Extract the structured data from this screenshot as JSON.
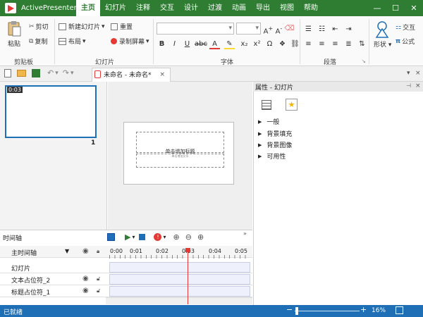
{
  "app": {
    "name": "ActivePresenter"
  },
  "menu_tabs": [
    "主页",
    "幻灯片",
    "注释",
    "交互",
    "设计",
    "过渡",
    "动画",
    "导出",
    "视图",
    "帮助"
  ],
  "ribbon": {
    "clipboard": {
      "paste": "粘贴",
      "cut": "剪切",
      "copy": "复制",
      "label": "剪贴板"
    },
    "slides": {
      "new_slide": "新建幻灯片",
      "reset": "重置",
      "layout": "布局",
      "record": "录制屏幕",
      "label": "幻灯片"
    },
    "font": {
      "label": "字体"
    },
    "paragraph": {
      "label": "段落"
    },
    "drawing": {
      "shape": "形状",
      "interact": "交互",
      "formula": "公式"
    }
  },
  "document": {
    "tab": "未命名 - 未命名*"
  },
  "slides_panel": {
    "thumb_duration": "0:03",
    "slide_number": "1"
  },
  "canvas": {
    "title_placeholder": "单击增加标题",
    "body_placeholder": "单击增加文本"
  },
  "properties": {
    "header": "属性 - 幻灯片",
    "sections": [
      "一般",
      "背景填充",
      "背景图像",
      "可用性"
    ]
  },
  "timeline": {
    "title": "时间轴",
    "main_timeline": "主时间轴",
    "ticks": [
      "0:00",
      "0:01",
      "0:02",
      "0:03",
      "0:04",
      "0:05"
    ],
    "rows": [
      "幻灯片",
      "文本占位符_2",
      "标题占位符_1"
    ]
  },
  "status": {
    "text": "已就绪",
    "zoom": "16%"
  },
  "colors": {
    "titlebar": "#2e7d32",
    "statusbar": "#1e6fb5",
    "accent": "#1e6fb5"
  }
}
